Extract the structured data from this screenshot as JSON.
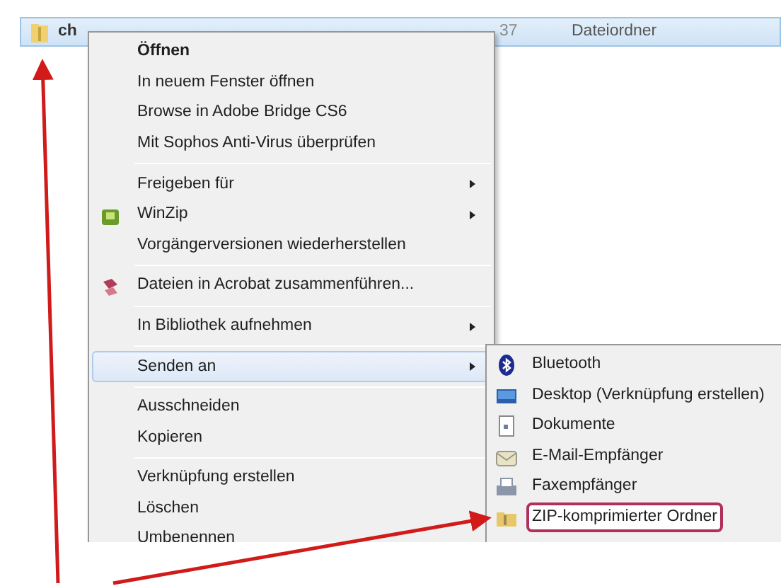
{
  "file_row": {
    "name": "ch",
    "date": "37",
    "type": "Dateiordner",
    "selected": true
  },
  "context_menu": {
    "items": [
      {
        "kind": "item",
        "label": "Öffnen",
        "default": true,
        "submenu": false,
        "selected": false
      },
      {
        "kind": "item",
        "label": "In neuem Fenster öffnen",
        "default": false,
        "submenu": false,
        "selected": false
      },
      {
        "kind": "item",
        "label": "Browse in Adobe Bridge CS6",
        "default": false,
        "submenu": false,
        "selected": false
      },
      {
        "kind": "item",
        "label": "Mit Sophos Anti-Virus überprüfen",
        "default": false,
        "submenu": false,
        "selected": false
      },
      {
        "kind": "separator"
      },
      {
        "kind": "item",
        "label": "Freigeben für",
        "default": false,
        "submenu": true,
        "selected": false
      },
      {
        "kind": "item",
        "label": "WinZip",
        "default": false,
        "submenu": true,
        "selected": false
      },
      {
        "kind": "item",
        "label": "Vorgängerversionen wiederherstellen",
        "default": false,
        "submenu": false,
        "selected": false
      },
      {
        "kind": "separator"
      },
      {
        "kind": "item",
        "label": "Dateien in Acrobat zusammenführen...",
        "default": false,
        "submenu": false,
        "selected": false
      },
      {
        "kind": "separator"
      },
      {
        "kind": "item",
        "label": "In Bibliothek aufnehmen",
        "default": false,
        "submenu": true,
        "selected": false
      },
      {
        "kind": "separator"
      },
      {
        "kind": "item",
        "label": "Senden an",
        "default": false,
        "submenu": true,
        "selected": true
      },
      {
        "kind": "separator"
      },
      {
        "kind": "item",
        "label": "Ausschneiden",
        "default": false,
        "submenu": false,
        "selected": false
      },
      {
        "kind": "item",
        "label": "Kopieren",
        "default": false,
        "submenu": false,
        "selected": false
      },
      {
        "kind": "separator"
      },
      {
        "kind": "item",
        "label": "Verknüpfung erstellen",
        "default": false,
        "submenu": false,
        "selected": false
      },
      {
        "kind": "item",
        "label": "Löschen",
        "default": false,
        "submenu": false,
        "selected": false
      },
      {
        "kind": "item",
        "label": "Umbenennen",
        "default": false,
        "submenu": false,
        "selected": false
      }
    ]
  },
  "send_to_menu": {
    "items": [
      {
        "label": "Bluetooth",
        "highlighted": false
      },
      {
        "label": "Desktop (Verknüpfung erstellen)",
        "highlighted": false
      },
      {
        "label": "Dokumente",
        "highlighted": false
      },
      {
        "label": "E-Mail-Empfänger",
        "highlighted": false
      },
      {
        "label": "Faxempfänger",
        "highlighted": false
      },
      {
        "label": "ZIP-komprimierter Ordner",
        "highlighted": true
      }
    ]
  }
}
